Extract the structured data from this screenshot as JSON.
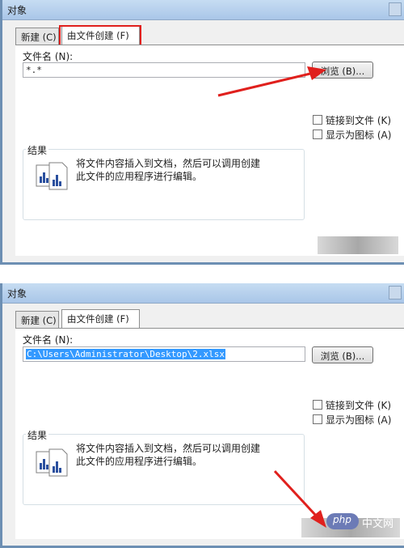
{
  "dialogs": [
    {
      "title": "对象",
      "tabs": [
        "新建 (C)",
        "由文件创建 (F)"
      ],
      "filename_label": "文件名 (N):",
      "filename_value": "*.*",
      "browse_label": "浏览 (B)...",
      "link_label": "链接到文件 (K)",
      "display_icon_label": "显示为图标 (A)",
      "result_title": "结果",
      "result_line1": "将文件内容插入到文档，然后可以调用创建",
      "result_line2": "此文件的应用程序进行编辑。"
    },
    {
      "title": "对象",
      "tabs": [
        "新建 (C)",
        "由文件创建 (F)"
      ],
      "filename_label": "文件名 (N):",
      "filename_value": "C:\\Users\\Administrator\\Desktop\\2.xlsx",
      "browse_label": "浏览 (B)...",
      "link_label": "链接到文件 (K)",
      "display_icon_label": "显示为图标 (A)",
      "result_title": "结果",
      "result_line1": "将文件内容插入到文档，然后可以调用创建",
      "result_line2": "此文件的应用程序进行编辑。"
    }
  ],
  "watermark": {
    "logo": "php",
    "site": "中文网"
  },
  "colors": {
    "annotation": "#e0201d",
    "selection": "#3399ff"
  }
}
